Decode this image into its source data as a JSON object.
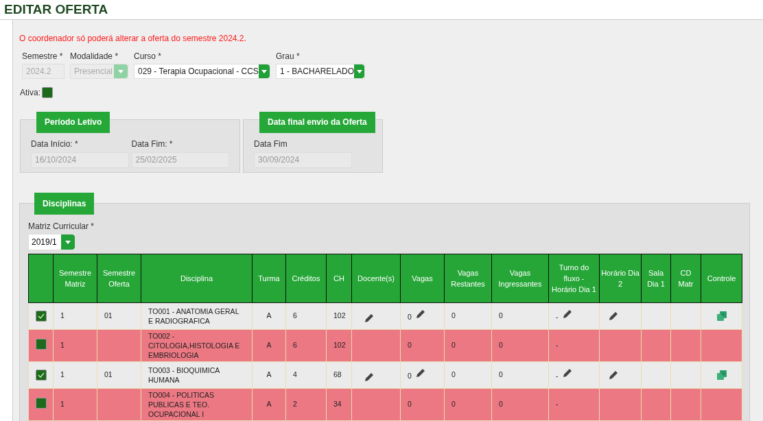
{
  "page_title": "EDITAR OFERTA",
  "warning": "O coordenador só poderá alterar a oferta do semestre 2024.2.",
  "fields": [
    {
      "label": "Semestre *",
      "value": "2024.2",
      "kind": "text",
      "disabled": true
    },
    {
      "label": "Modalidade *",
      "value": "Presencial",
      "kind": "select",
      "disabled": true
    },
    {
      "label": "Curso *",
      "value": "029 - Terapia Ocupacional - CCS",
      "kind": "select",
      "disabled": false
    },
    {
      "label": "Grau *",
      "value": "1 - BACHARELADO",
      "kind": "select",
      "disabled": false
    }
  ],
  "ativa": {
    "label": "Ativa:",
    "checked": false
  },
  "periodo": {
    "title": "Período Letivo",
    "fields": [
      {
        "label": "Data Início: *",
        "value": "16/10/2024"
      },
      {
        "label": "Data Fim: *",
        "value": "25/02/2025"
      }
    ]
  },
  "envio": {
    "title": "Data final envio da Oferta",
    "fields": [
      {
        "label": "Data Fim",
        "value": "30/09/2024"
      }
    ]
  },
  "disciplinas": {
    "title": "Disciplinas",
    "matriz_label": "Matriz Curricular *",
    "matriz_value": "2019/1",
    "columns": [
      "",
      "Semestre Matriz",
      "Semestre Oferta",
      "Disciplina",
      "Turma",
      "Créditos",
      "CH",
      "Docente(s)",
      "Vagas",
      "Vagas Restantes",
      "Vagas Ingressantes",
      "Turno do fluxo - Horário Dia 1",
      "Horário Dia 2",
      "Sala Dia 1",
      "CD Matr",
      "Controle"
    ],
    "rows": [
      {
        "checked": true,
        "semestre_matriz": "1",
        "semestre_oferta": "01",
        "disciplina": "TO001 - ANATOMIA GERAL E RADIOGRAFICA",
        "turma": "A",
        "creditos": "6",
        "ch": "102",
        "vagas": "0",
        "vagas_restantes": "0",
        "vagas_ingressantes": "0",
        "turno": "-"
      },
      {
        "checked": false,
        "semestre_matriz": "1",
        "semestre_oferta": "",
        "disciplina": "TO002 - CITOLOGIA,HISTOLOGIA E EMBRIOLOGIA",
        "turma": "A",
        "creditos": "6",
        "ch": "102",
        "vagas": "0",
        "vagas_restantes": "0",
        "vagas_ingressantes": "0",
        "turno": "-"
      },
      {
        "checked": true,
        "semestre_matriz": "1",
        "semestre_oferta": "01",
        "disciplina": "TO003 - BIOQUIMICA HUMANA",
        "turma": "A",
        "creditos": "4",
        "ch": "68",
        "vagas": "0",
        "vagas_restantes": "0",
        "vagas_ingressantes": "0",
        "turno": "-"
      },
      {
        "checked": false,
        "semestre_matriz": "1",
        "semestre_oferta": "",
        "disciplina": "TO004 - POLITICAS PUBLICAS E TEO. OCUPACIONAL I",
        "turma": "A",
        "creditos": "2",
        "ch": "34",
        "vagas": "0",
        "vagas_restantes": "0",
        "vagas_ingressantes": "0",
        "turno": "-"
      }
    ]
  }
}
